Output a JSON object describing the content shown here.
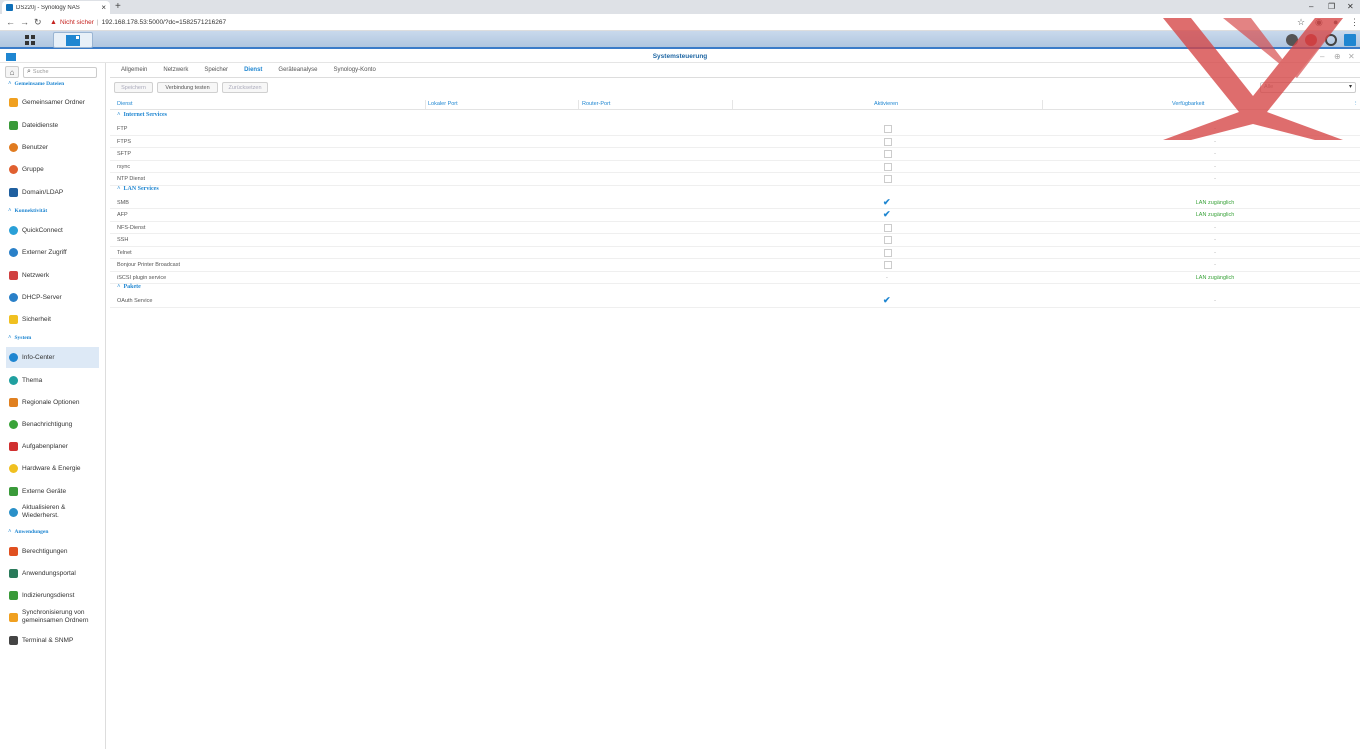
{
  "browser": {
    "tab_title": "DS220j - Synology NAS",
    "new_tab": "+",
    "address_warning": "Nicht sicher",
    "url": "192.168.178.53:5000/?dc=1582571216267"
  },
  "window": {
    "title": "Systemsteuerung"
  },
  "sidebar": {
    "search_placeholder": "Suche",
    "sections": [
      {
        "label": "Gemeinsame Dateien"
      },
      {
        "label": "Konnektivität"
      },
      {
        "label": "System"
      },
      {
        "label": "Anwendungen"
      }
    ],
    "items": [
      {
        "label": "Gemeinsamer Ordner",
        "color": "#f0a020"
      },
      {
        "label": "Dateidienste",
        "color": "#3a9a3a"
      },
      {
        "label": "Benutzer",
        "color": "#e07b20"
      },
      {
        "label": "Gruppe",
        "color": "#e06030"
      },
      {
        "label": "Domain/LDAP",
        "color": "#1f5f9f"
      },
      {
        "label": "QuickConnect",
        "color": "#2aa0d8"
      },
      {
        "label": "Externer Zugriff",
        "color": "#2a80c8"
      },
      {
        "label": "Netzwerk",
        "color": "#d04040"
      },
      {
        "label": "DHCP-Server",
        "color": "#2a80c8"
      },
      {
        "label": "Sicherheit",
        "color": "#f0c020"
      },
      {
        "label": "Info-Center",
        "color": "#1f86d1"
      },
      {
        "label": "Thema",
        "color": "#20a0a0"
      },
      {
        "label": "Regionale Optionen",
        "color": "#e08020"
      },
      {
        "label": "Benachrichtigung",
        "color": "#3aa33a"
      },
      {
        "label": "Aufgabenplaner",
        "color": "#d03030"
      },
      {
        "label": "Hardware & Energie",
        "color": "#f0c020"
      },
      {
        "label": "Externe Geräte",
        "color": "#3a9a3a"
      },
      {
        "label": "Aktualisieren & Wiederherst.",
        "color": "#2a90c8"
      },
      {
        "label": "Berechtigungen",
        "color": "#e05020"
      },
      {
        "label": "Anwendungsportal",
        "color": "#2a7a5a"
      },
      {
        "label": "Indizierungsdienst",
        "color": "#3a9a3a"
      },
      {
        "label": "Synchronisierung von gemeinsamen Ordnern",
        "color": "#f0a020"
      },
      {
        "label": "Terminal & SNMP",
        "color": "#444444"
      }
    ]
  },
  "main": {
    "tabs": [
      "Allgemein",
      "Netzwerk",
      "Speicher",
      "Dienst",
      "Geräteanalyse",
      "Synology-Konto"
    ],
    "active_tab": "Dienst",
    "toolbar": {
      "save": "Speichern",
      "test": "Verbindung testen",
      "reset": "Zurücksetzen",
      "filter": "Alle"
    },
    "columns": [
      "Dienst",
      "Lokaler Port",
      "Router-Port",
      "Aktivieren",
      "Verfügbarkeit"
    ],
    "groups": [
      {
        "label": "Internet Services",
        "rows": [
          {
            "name": "FTP",
            "enabled": "off",
            "access": "-"
          },
          {
            "name": "FTPS",
            "enabled": "off",
            "access": "-"
          },
          {
            "name": "SFTP",
            "enabled": "off",
            "access": "-"
          },
          {
            "name": "rsync",
            "enabled": "off",
            "access": "-"
          },
          {
            "name": "NTP Dienst",
            "enabled": "off",
            "access": "-"
          }
        ]
      },
      {
        "label": "LAN Services",
        "rows": [
          {
            "name": "SMB",
            "enabled": "on",
            "access": "LAN zugänglich"
          },
          {
            "name": "AFP",
            "enabled": "on",
            "access": "LAN zugänglich"
          },
          {
            "name": "NFS-Dienst",
            "enabled": "off",
            "access": "-"
          },
          {
            "name": "SSH",
            "enabled": "off",
            "access": "-"
          },
          {
            "name": "Telnet",
            "enabled": "off",
            "access": "-"
          },
          {
            "name": "Bonjour Printer Broadcast",
            "enabled": "off",
            "access": "-"
          },
          {
            "name": "iSCSI plugin service",
            "enabled": "none",
            "access": "LAN zugänglich"
          }
        ]
      },
      {
        "label": "Pakete",
        "rows": [
          {
            "name": "OAuth Service",
            "enabled": "on",
            "access": "-"
          }
        ]
      }
    ]
  }
}
